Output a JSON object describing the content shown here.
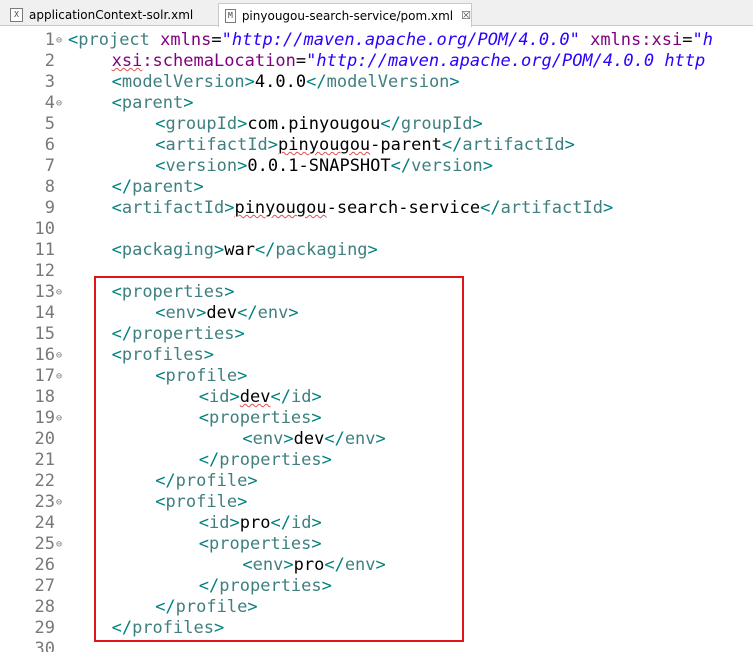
{
  "tabs": [
    {
      "label": "applicationContext-solr.xml",
      "icon": "X",
      "active": false
    },
    {
      "label": "pinyougou-search-service/pom.xml",
      "icon": "M",
      "active": true,
      "close": "☒"
    }
  ],
  "lines": [
    {
      "n": "1",
      "fold": true,
      "indent": 0,
      "tokens": [
        [
          "br",
          "<"
        ],
        [
          "tag",
          "project"
        ],
        [
          "txt",
          " "
        ],
        [
          "attr",
          "xmlns"
        ],
        [
          "txt",
          "="
        ],
        [
          "val",
          "\"http://maven.apache.org/POM/4.0.0\""
        ],
        [
          "txt",
          " "
        ],
        [
          "attr",
          "xmlns:xsi"
        ],
        [
          "txt",
          "="
        ],
        [
          "val",
          "\"h"
        ]
      ]
    },
    {
      "n": "2",
      "indent": 2,
      "tokens": [
        [
          "attr sq",
          "xsi"
        ],
        [
          "attr",
          ":schemaLocation"
        ],
        [
          "txt",
          "="
        ],
        [
          "val",
          "\"http://maven.apache.org/POM/4.0.0 http"
        ]
      ]
    },
    {
      "n": "3",
      "indent": 2,
      "tokens": [
        [
          "br",
          "<"
        ],
        [
          "tag",
          "modelVersion"
        ],
        [
          "br",
          ">"
        ],
        [
          "txt",
          "4.0.0"
        ],
        [
          "br",
          "</"
        ],
        [
          "tag",
          "modelVersion"
        ],
        [
          "br",
          ">"
        ]
      ]
    },
    {
      "n": "4",
      "fold": true,
      "indent": 2,
      "tokens": [
        [
          "br",
          "<"
        ],
        [
          "tag",
          "parent"
        ],
        [
          "br",
          ">"
        ]
      ]
    },
    {
      "n": "5",
      "indent": 4,
      "tokens": [
        [
          "br",
          "<"
        ],
        [
          "tag",
          "groupId"
        ],
        [
          "br",
          ">"
        ],
        [
          "txt",
          "com.pinyougou"
        ],
        [
          "br",
          "</"
        ],
        [
          "tag",
          "groupId"
        ],
        [
          "br",
          ">"
        ]
      ]
    },
    {
      "n": "6",
      "indent": 4,
      "tokens": [
        [
          "br",
          "<"
        ],
        [
          "tag",
          "artifactId"
        ],
        [
          "br",
          ">"
        ],
        [
          "txt sq",
          "pinyougou"
        ],
        [
          "txt",
          "-parent"
        ],
        [
          "br",
          "</"
        ],
        [
          "tag",
          "artifactId"
        ],
        [
          "br",
          ">"
        ]
      ]
    },
    {
      "n": "7",
      "indent": 4,
      "tokens": [
        [
          "br",
          "<"
        ],
        [
          "tag",
          "version"
        ],
        [
          "br",
          ">"
        ],
        [
          "txt",
          "0.0.1-SNAPSHOT"
        ],
        [
          "br",
          "</"
        ],
        [
          "tag",
          "version"
        ],
        [
          "br",
          ">"
        ]
      ]
    },
    {
      "n": "8",
      "indent": 2,
      "tokens": [
        [
          "br",
          "</"
        ],
        [
          "tag",
          "parent"
        ],
        [
          "br",
          ">"
        ]
      ]
    },
    {
      "n": "9",
      "indent": 2,
      "tokens": [
        [
          "br",
          "<"
        ],
        [
          "tag",
          "artifactId"
        ],
        [
          "br",
          ">"
        ],
        [
          "txt sq",
          "pinyougou"
        ],
        [
          "txt",
          "-search-service"
        ],
        [
          "br",
          "</"
        ],
        [
          "tag",
          "artifactId"
        ],
        [
          "br",
          ">"
        ]
      ]
    },
    {
      "n": "10",
      "indent": 0,
      "tokens": []
    },
    {
      "n": "11",
      "indent": 2,
      "tokens": [
        [
          "br",
          "<"
        ],
        [
          "tag",
          "packaging"
        ],
        [
          "br",
          ">"
        ],
        [
          "txt",
          "war"
        ],
        [
          "br",
          "</"
        ],
        [
          "tag",
          "packaging"
        ],
        [
          "br",
          ">"
        ]
      ]
    },
    {
      "n": "12",
      "indent": 0,
      "tokens": []
    },
    {
      "n": "13",
      "fold": true,
      "indent": 2,
      "tokens": [
        [
          "br",
          "<"
        ],
        [
          "tag",
          "properties"
        ],
        [
          "br",
          ">"
        ]
      ]
    },
    {
      "n": "14",
      "indent": 4,
      "tokens": [
        [
          "br",
          "<"
        ],
        [
          "tag",
          "env"
        ],
        [
          "br",
          ">"
        ],
        [
          "txt",
          "dev"
        ],
        [
          "br",
          "</"
        ],
        [
          "tag",
          "env"
        ],
        [
          "br",
          ">"
        ]
      ]
    },
    {
      "n": "15",
      "indent": 2,
      "tokens": [
        [
          "br",
          "</"
        ],
        [
          "tag",
          "properties"
        ],
        [
          "br",
          ">"
        ]
      ]
    },
    {
      "n": "16",
      "fold": true,
      "indent": 2,
      "tokens": [
        [
          "br",
          "<"
        ],
        [
          "tag",
          "profiles"
        ],
        [
          "br",
          ">"
        ]
      ]
    },
    {
      "n": "17",
      "fold": true,
      "indent": 4,
      "tokens": [
        [
          "br",
          "<"
        ],
        [
          "tag",
          "profile"
        ],
        [
          "br",
          ">"
        ]
      ]
    },
    {
      "n": "18",
      "indent": 6,
      "tokens": [
        [
          "br",
          "<"
        ],
        [
          "tag",
          "id"
        ],
        [
          "br",
          ">"
        ],
        [
          "txt sq",
          "dev"
        ],
        [
          "br",
          "</"
        ],
        [
          "tag",
          "id"
        ],
        [
          "br",
          ">"
        ]
      ]
    },
    {
      "n": "19",
      "fold": true,
      "indent": 6,
      "tokens": [
        [
          "br",
          "<"
        ],
        [
          "tag",
          "properties"
        ],
        [
          "br",
          ">"
        ]
      ]
    },
    {
      "n": "20",
      "indent": 8,
      "tokens": [
        [
          "br",
          "<"
        ],
        [
          "tag",
          "env"
        ],
        [
          "br",
          ">"
        ],
        [
          "txt",
          "dev"
        ],
        [
          "br",
          "</"
        ],
        [
          "tag",
          "env"
        ],
        [
          "br",
          ">"
        ]
      ]
    },
    {
      "n": "21",
      "indent": 6,
      "tokens": [
        [
          "br",
          "</"
        ],
        [
          "tag",
          "properties"
        ],
        [
          "br",
          ">"
        ]
      ]
    },
    {
      "n": "22",
      "indent": 4,
      "tokens": [
        [
          "br",
          "</"
        ],
        [
          "tag",
          "profile"
        ],
        [
          "br",
          ">"
        ]
      ]
    },
    {
      "n": "23",
      "fold": true,
      "indent": 4,
      "tokens": [
        [
          "br",
          "<"
        ],
        [
          "tag",
          "profile"
        ],
        [
          "br",
          ">"
        ]
      ]
    },
    {
      "n": "24",
      "indent": 6,
      "tokens": [
        [
          "br",
          "<"
        ],
        [
          "tag",
          "id"
        ],
        [
          "br",
          ">"
        ],
        [
          "txt",
          "pro"
        ],
        [
          "br",
          "</"
        ],
        [
          "tag",
          "id"
        ],
        [
          "br",
          ">"
        ]
      ]
    },
    {
      "n": "25",
      "fold": true,
      "indent": 6,
      "tokens": [
        [
          "br",
          "<"
        ],
        [
          "tag",
          "properties"
        ],
        [
          "br",
          ">"
        ]
      ]
    },
    {
      "n": "26",
      "indent": 8,
      "tokens": [
        [
          "br",
          "<"
        ],
        [
          "tag",
          "env"
        ],
        [
          "br",
          ">"
        ],
        [
          "txt",
          "pro"
        ],
        [
          "br",
          "</"
        ],
        [
          "tag",
          "env"
        ],
        [
          "br",
          ">"
        ]
      ]
    },
    {
      "n": "27",
      "indent": 6,
      "tokens": [
        [
          "br",
          "</"
        ],
        [
          "tag",
          "properties"
        ],
        [
          "br",
          ">"
        ]
      ]
    },
    {
      "n": "28",
      "indent": 4,
      "tokens": [
        [
          "br",
          "</"
        ],
        [
          "tag",
          "profile"
        ],
        [
          "br",
          ">"
        ]
      ]
    },
    {
      "n": "29",
      "indent": 2,
      "tokens": [
        [
          "br",
          "</"
        ],
        [
          "tag",
          "profiles"
        ],
        [
          "br",
          ">"
        ]
      ]
    },
    {
      "n": "30",
      "indent": 0,
      "tokens": []
    }
  ],
  "highlight_color": "#e0151b"
}
